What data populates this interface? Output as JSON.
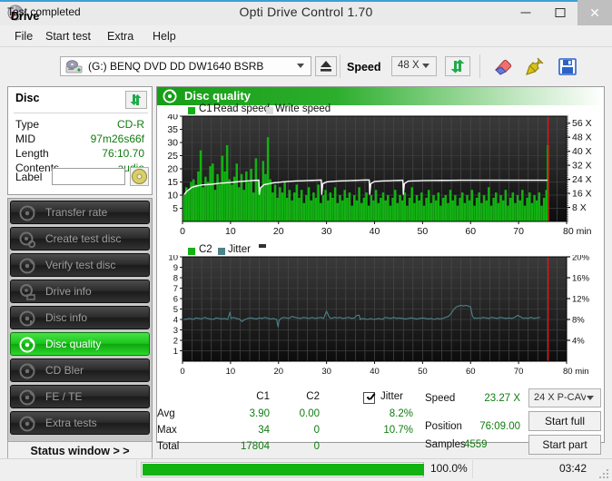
{
  "window": {
    "title": "Opti Drive Control 1.70",
    "icon": "disc-app-icon",
    "minimize": "–",
    "maximize": "□",
    "close": "✕"
  },
  "menu": {
    "items": [
      "File",
      "Start test",
      "Extra",
      "Help"
    ]
  },
  "toolbar": {
    "drive_label": "Drive",
    "drive_value": "(G:)   BENQ DVD DD DW1640 BSRB",
    "eject_icon": "eject-icon",
    "speed_label": "Speed",
    "speed_value": "48 X",
    "refresh_icon": "refresh-icon",
    "erase_icon": "eraser-icon",
    "pin_icon": "pin-icon",
    "save_icon": "save-icon"
  },
  "disc": {
    "title": "Disc",
    "refresh_icon": "refresh-icon",
    "fields": [
      {
        "label": "Type",
        "value": "CD-R"
      },
      {
        "label": "MID",
        "value": "97m26s66f"
      },
      {
        "label": "Length",
        "value": "76:10.70"
      },
      {
        "label": "Contents",
        "value": "audio"
      }
    ],
    "label_field_label": "Label",
    "label_field_value": "",
    "label_button_icon": "disc-icon"
  },
  "sidebar": {
    "items": [
      {
        "label": "Transfer rate",
        "icon": "disc-icon",
        "active": false
      },
      {
        "label": "Create test disc",
        "icon": "disc-write-icon",
        "active": false
      },
      {
        "label": "Verify test disc",
        "icon": "disc-check-icon",
        "active": false
      },
      {
        "label": "Drive info",
        "icon": "drive-icon",
        "active": false
      },
      {
        "label": "Disc info",
        "icon": "disc-info-icon",
        "active": false
      },
      {
        "label": "Disc quality",
        "icon": "disc-quality-icon",
        "active": true
      },
      {
        "label": "CD Bler",
        "icon": "disc-icon",
        "active": false
      },
      {
        "label": "FE / TE",
        "icon": "disc-icon",
        "active": false
      },
      {
        "label": "Extra tests",
        "icon": "disc-icon",
        "active": false
      }
    ],
    "status_window_button": "Status window > >"
  },
  "main": {
    "header_title": "Disc quality",
    "header_icon": "disc-quality-icon"
  },
  "statistics": {
    "columns": [
      "C1",
      "C2"
    ],
    "jitter_checkbox_checked": true,
    "jitter_label": "Jitter",
    "rows": [
      {
        "label": "Avg",
        "c1": "3.90",
        "c2": "0.00",
        "jitter": "8.2%"
      },
      {
        "label": "Max",
        "c1": "34",
        "c2": "0",
        "jitter": "10.7%"
      },
      {
        "label": "Total",
        "c1": "17804",
        "c2": "0",
        "jitter": ""
      }
    ],
    "right": [
      {
        "label": "Speed",
        "value": "23.27 X"
      },
      {
        "label": "Position",
        "value": "76:09.00"
      },
      {
        "label": "Samples",
        "value": "4559"
      }
    ],
    "write_speed_value": "24 X P-CAV",
    "start_full_button": "Start full",
    "start_part_button": "Start part"
  },
  "statusbar": {
    "status_text": "Test completed",
    "progress_percent": 100.0,
    "progress_text": "100.0%",
    "elapsed_time": "03:42"
  },
  "chart_data": [
    {
      "id": "c1-chart",
      "type": "bar",
      "title": "",
      "xlabel": "min",
      "ylabel": "",
      "xlim": [
        0,
        80
      ],
      "ylim": [
        0,
        40
      ],
      "xticks": [
        0,
        10,
        20,
        30,
        40,
        50,
        60,
        70,
        80
      ],
      "xticklabels": [
        "0",
        "10",
        "20",
        "30",
        "40",
        "50",
        "60",
        "70",
        "80 min"
      ],
      "yticks": [
        5,
        10,
        15,
        20,
        25,
        30,
        35,
        40
      ],
      "y2label": "X",
      "y2lim": [
        0,
        60
      ],
      "y2ticks": [
        8,
        16,
        24,
        32,
        40,
        48,
        56
      ],
      "y2ticklabels": [
        "8 X",
        "16 X",
        "24 X",
        "32 X",
        "40 X",
        "48 X",
        "56 X"
      ],
      "grid": true,
      "background": "#1b1b1b",
      "legend": [
        {
          "label": "C1",
          "color": "#12b212"
        },
        {
          "label": "Read speed",
          "color": "#ffffff"
        },
        {
          "label": "Write speed",
          "color": "#dcdcdc"
        }
      ],
      "marker_line": {
        "x": 76.15,
        "color": "#e01313"
      },
      "series": [
        {
          "name": "C1",
          "kind": "bars",
          "color": "#12b212",
          "x": [
            0.3,
            0.8,
            1.3,
            1.8,
            2.3,
            2.8,
            3.3,
            3.8,
            4.3,
            4.8,
            5.3,
            5.8,
            6.3,
            6.8,
            7.3,
            7.8,
            8.3,
            8.8,
            9.3,
            9.8,
            10.3,
            10.8,
            11.3,
            11.8,
            12.3,
            12.8,
            13.3,
            13.8,
            14.3,
            14.8,
            15.3,
            15.8,
            16.3,
            16.8,
            17.3,
            17.8,
            18.3,
            18.8,
            19.3,
            19.8,
            20.3,
            20.8,
            21.3,
            21.8,
            22.3,
            22.8,
            23.3,
            23.8,
            24.3,
            24.8,
            25.3,
            25.8,
            26.3,
            26.8,
            27.3,
            27.8,
            28.3,
            28.8,
            29.3,
            29.8,
            30.3,
            30.8,
            31.3,
            31.8,
            32.3,
            32.8,
            33.3,
            33.8,
            34.3,
            34.8,
            35.3,
            35.8,
            36.3,
            36.8,
            37.3,
            37.8,
            38.3,
            38.8,
            39.3,
            39.8,
            40.3,
            40.8,
            41.3,
            41.8,
            42.3,
            42.8,
            43.3,
            43.8,
            44.3,
            44.8,
            45.3,
            45.8,
            46.3,
            46.8,
            47.3,
            47.8,
            48.3,
            48.8,
            49.3,
            49.8,
            50.3,
            50.8,
            51.3,
            51.8,
            52.3,
            52.8,
            53.3,
            53.8,
            54.3,
            54.8,
            55.3,
            55.8,
            56.3,
            56.8,
            57.3,
            57.8,
            58.3,
            58.8,
            59.3,
            59.8,
            60.3,
            60.8,
            61.3,
            61.8,
            62.3,
            62.8,
            63.3,
            63.8,
            64.3,
            64.8,
            65.3,
            65.8,
            66.3,
            66.8,
            67.3,
            67.8,
            68.3,
            68.8,
            69.3,
            69.8,
            70.3,
            70.8,
            71.3,
            71.8,
            72.3,
            72.8,
            73.3,
            73.8,
            74.3,
            74.8,
            75.3,
            75.8,
            76.1
          ],
          "values": [
            10,
            13,
            12,
            15,
            16,
            14,
            19,
            27,
            13,
            17,
            15,
            21,
            22,
            12,
            18,
            14,
            25,
            19,
            29,
            16,
            14,
            17,
            22,
            13,
            18,
            12,
            19,
            15,
            20,
            11,
            24,
            16,
            13,
            23,
            18,
            32,
            16,
            11,
            14,
            9,
            13,
            11,
            15,
            9,
            12,
            8,
            11,
            14,
            9,
            12,
            7,
            10,
            13,
            8,
            11,
            9,
            14,
            7,
            10,
            12,
            8,
            11,
            9,
            13,
            7,
            10,
            8,
            12,
            9,
            11,
            6,
            10,
            8,
            13,
            7,
            9,
            11,
            6,
            10,
            8,
            12,
            7,
            9,
            11,
            8,
            10,
            6,
            9,
            12,
            7,
            10,
            8,
            11,
            6,
            9,
            13,
            7,
            10,
            8,
            11,
            6,
            9,
            12,
            7,
            10,
            8,
            11,
            6,
            9,
            10,
            7,
            12,
            8,
            10,
            6,
            9,
            11,
            7,
            10,
            8,
            12,
            6,
            9,
            11,
            7,
            10,
            8,
            13,
            6,
            9,
            11,
            7,
            10,
            8,
            12,
            6,
            9,
            11,
            7,
            10,
            8,
            12,
            6,
            9,
            11,
            7,
            10,
            8,
            11,
            6,
            9,
            12,
            29,
            34
          ]
        },
        {
          "name": "Read speed",
          "kind": "line",
          "color": "#ffffff",
          "axis": "right",
          "x": [
            0.4,
            1,
            2,
            3,
            4,
            5,
            6,
            7,
            8,
            9,
            10,
            11,
            12,
            13,
            14,
            15,
            15.9,
            16.0,
            16.2,
            17,
            18,
            19,
            20,
            21,
            22,
            23,
            24,
            25,
            26,
            27,
            28,
            28.9,
            29.0,
            29.2,
            30,
            31,
            32,
            33,
            34,
            35,
            36,
            37,
            38,
            38.9,
            39.0,
            39.2,
            40,
            41,
            42,
            43,
            44,
            45,
            45.9,
            46.0,
            46.2,
            47,
            48,
            49,
            50,
            52,
            54,
            56,
            58,
            60,
            62,
            64,
            66,
            68,
            70,
            72,
            74,
            76,
            76.15
          ],
          "values_x": [
            15.5,
            17.5,
            19.5,
            20.2,
            20.8,
            21,
            21.2,
            21.5,
            21.8,
            22,
            22.2,
            22.5,
            22.8,
            23,
            23.2,
            23.4,
            23.5,
            15.5,
            19.0,
            21.0,
            21.5,
            22,
            22.3,
            22.6,
            22.8,
            23,
            23.1,
            23.2,
            23.3,
            23.4,
            23.5,
            23.6,
            15.5,
            21.5,
            22.5,
            22.8,
            23,
            23.1,
            23.2,
            23.3,
            23.4,
            23.5,
            23.6,
            23.6,
            15.5,
            21.5,
            22.8,
            23,
            23.1,
            23.2,
            23.3,
            23.4,
            23.5,
            15.5,
            21.5,
            23,
            23.1,
            23.2,
            23.3,
            23.35,
            23.4,
            23.45,
            23.5,
            23.5,
            23.5,
            23.5,
            23.5,
            23.5,
            23.5,
            23.5,
            23.5,
            23.5,
            23.5,
            23.5
          ]
        }
      ]
    },
    {
      "id": "c2-jitter-chart",
      "type": "line",
      "title": "",
      "xlabel": "min",
      "ylabel": "",
      "xlim": [
        0,
        80
      ],
      "ylim": [
        0,
        10
      ],
      "xticks": [
        0,
        10,
        20,
        30,
        40,
        50,
        60,
        70,
        80
      ],
      "xticklabels": [
        "0",
        "10",
        "20",
        "30",
        "40",
        "50",
        "60",
        "70",
        "80 min"
      ],
      "yticks": [
        1,
        2,
        3,
        4,
        5,
        6,
        7,
        8,
        9,
        10
      ],
      "y2lim": [
        0,
        20
      ],
      "y2ticks": [
        4,
        8,
        12,
        16,
        20
      ],
      "y2ticklabels": [
        "4%",
        "8%",
        "12%",
        "16%",
        "20%"
      ],
      "grid": true,
      "background": "#1b1b1b",
      "legend": [
        {
          "label": "C2",
          "color": "#12b212"
        },
        {
          "label": "Jitter",
          "color": "#4d8289"
        }
      ],
      "marker_line": {
        "x": 76.15,
        "color": "#e01313"
      },
      "series": [
        {
          "name": "C2",
          "kind": "bars",
          "color": "#12b212",
          "x": [],
          "values": []
        },
        {
          "name": "Jitter",
          "kind": "line",
          "color": "#4d8289",
          "x": [
            0.3,
            1,
            1.6,
            2.2,
            2.8,
            3.4,
            4,
            4.6,
            5.2,
            5.8,
            6.4,
            7,
            7.6,
            8.2,
            8.8,
            9.4,
            9.9,
            10.1,
            10.6,
            11.2,
            11.8,
            12.4,
            13,
            13.6,
            14.2,
            14.8,
            15.4,
            16,
            16.6,
            17.2,
            17.8,
            18.4,
            19,
            19.6,
            19.9,
            20.1,
            20.5,
            21,
            21.6,
            22.2,
            22.8,
            23.4,
            24,
            24.6,
            25.2,
            25.8,
            26.4,
            27,
            27.6,
            28.2,
            28.8,
            29.4,
            30,
            30.4,
            30.6,
            31,
            31.6,
            32.2,
            32.8,
            33.4,
            34,
            34.6,
            35.2,
            35.8,
            36.4,
            36.8,
            37,
            37.4,
            38,
            38.6,
            39.2,
            39.8,
            40.4,
            41,
            41.6,
            42.2,
            42.8,
            43.4,
            44,
            44.6,
            45.2,
            45.8,
            46.4,
            47,
            47.6,
            48.2,
            48.8,
            49.4,
            50,
            50.6,
            51.2,
            51.8,
            52.4,
            53,
            53.6,
            54.2,
            54.8,
            55.4,
            56,
            56.4,
            56.8,
            57.2,
            57.6,
            58,
            58.5,
            59,
            59.5,
            60,
            60.4,
            60.8,
            61,
            61.3,
            61.6,
            62,
            62.6,
            63.2,
            63.8,
            64.4,
            65,
            65.6,
            66.2,
            66.8,
            67.4,
            68,
            68.6,
            69.2,
            69.8,
            70.4,
            70.8,
            71,
            71.4,
            72,
            72.6,
            73.2,
            73.8,
            74.4,
            75,
            75.6,
            76.1
          ],
          "values": [
            4.0,
            4.05,
            4.1,
            4.0,
            4.15,
            4.1,
            4.05,
            4.2,
            4.1,
            4.05,
            4.0,
            4.15,
            4.1,
            4.05,
            4.1,
            4.0,
            4.7,
            4.1,
            4.2,
            4.1,
            4.05,
            3.8,
            4.0,
            4.1,
            4.15,
            4.1,
            4.05,
            4.15,
            4.1,
            4.2,
            4.1,
            4.05,
            4.1,
            4.0,
            3.3,
            3.9,
            4.1,
            4.2,
            4.15,
            4.1,
            4.3,
            4.2,
            4.15,
            4.1,
            4.2,
            4.15,
            4.1,
            4.2,
            4.1,
            4.15,
            4.2,
            4.1,
            4.8,
            4.4,
            4.2,
            4.1,
            4.2,
            4.15,
            4.2,
            4.1,
            4.15,
            4.2,
            4.1,
            4.15,
            4.4,
            4.4,
            4.0,
            4.1,
            4.05,
            4.0,
            4.1,
            4.0,
            4.05,
            4.1,
            4.0,
            4.2,
            4.15,
            4.1,
            4.2,
            4.1,
            4.15,
            4.1,
            4.05,
            4.1,
            4.15,
            4.1,
            4.05,
            4.1,
            4.15,
            4.1,
            4.05,
            4.1,
            4.0,
            4.1,
            4.05,
            4.1,
            4.2,
            4.3,
            4.6,
            4.9,
            5.1,
            5.25,
            5.3,
            5.35,
            5.3,
            5.35,
            5.3,
            5.2,
            4.3,
            4.1,
            4.15,
            4.1,
            4.15,
            4.1,
            4.2,
            4.15,
            4.1,
            4.2,
            4.15,
            4.1,
            4.2,
            4.15,
            4.1,
            4.15,
            4.1,
            4.2,
            4.4,
            4.25,
            4.15,
            4.1,
            4.15,
            4.1,
            4.2,
            4.1,
            4.15,
            4.2
          ]
        }
      ]
    }
  ]
}
